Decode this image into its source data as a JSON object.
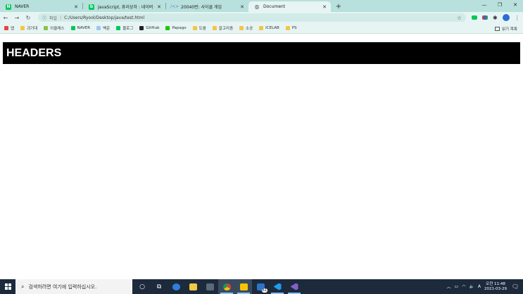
{
  "browser": {
    "tabs": [
      {
        "title": "NAVER",
        "favicon": "naver-icon",
        "color": "#03c75a",
        "active": false
      },
      {
        "title": "JavaScript, 휴리상자 : 네이버 블",
        "favicon": "naver-blog-icon",
        "color": "#03c75a",
        "active": false
      },
      {
        "title": "20040번: 사이클 게임",
        "favicon": "baekjoon-icon",
        "color": "#4a8fd6",
        "active": false
      },
      {
        "title": "Document",
        "favicon": "globe-icon",
        "color": "#5f6368",
        "active": true
      }
    ],
    "new_tab_label": "+",
    "window_controls": {
      "minimize": "—",
      "maximize": "❐",
      "close": "✕"
    },
    "address": {
      "scheme_label": "파일",
      "url": "C:/Users/Ryool/Desktop/java/test.html"
    },
    "bookmarks": [
      {
        "label": "앱",
        "icon": "apps-grid-icon",
        "color": "#e8453c"
      },
      {
        "label": "괴기대",
        "icon": "folder-icon",
        "color": "#f6c445"
      },
      {
        "label": "이클래스",
        "icon": "eclass-icon",
        "color": "#8bc34a"
      },
      {
        "label": "NAVER",
        "icon": "naver-icon",
        "color": "#03c75a"
      },
      {
        "label": "백준",
        "icon": "baekjoon-icon",
        "color": "#9ec6f0"
      },
      {
        "label": "블로그",
        "icon": "naver-blog-icon",
        "color": "#03c75a"
      },
      {
        "label": "GitHub",
        "icon": "github-icon",
        "color": "#222222"
      },
      {
        "label": "Papago",
        "icon": "papago-icon",
        "color": "#1ec800"
      },
      {
        "label": "도움",
        "icon": "folder-icon",
        "color": "#f6c445"
      },
      {
        "label": "알고리즘",
        "icon": "folder-icon",
        "color": "#f6c445"
      },
      {
        "label": "소공",
        "icon": "folder-icon",
        "color": "#f6c445"
      },
      {
        "label": "ICELAB",
        "icon": "folder-icon",
        "color": "#f6c445"
      },
      {
        "label": "PS",
        "icon": "folder-icon",
        "color": "#f6c445"
      }
    ],
    "reading_list_label": "읽기 목록"
  },
  "page": {
    "header_text": "HEADERS",
    "header_bg": "#000000",
    "header_color": "#ffffff"
  },
  "taskbar": {
    "search_placeholder": "검색하려면 여기에 입력하십시오.",
    "apps": [
      "cortana-icon",
      "task-view-icon",
      "edge-legacy-icon",
      "file-explorer-icon",
      "calculator-icon",
      "chrome-icon",
      "sticky-notes-icon",
      "mail-icon",
      "vscode-icon",
      "visual-studio-icon"
    ],
    "mail_badge": "61",
    "tray": {
      "ime": "A",
      "time": "오전 11:48",
      "date": "2021-03-29"
    }
  },
  "theme": {
    "tabstrip_bg": "#b8e0dc",
    "toolbar_bg": "#e6f5f4",
    "taskbar_bg": "#1c2a3c"
  }
}
